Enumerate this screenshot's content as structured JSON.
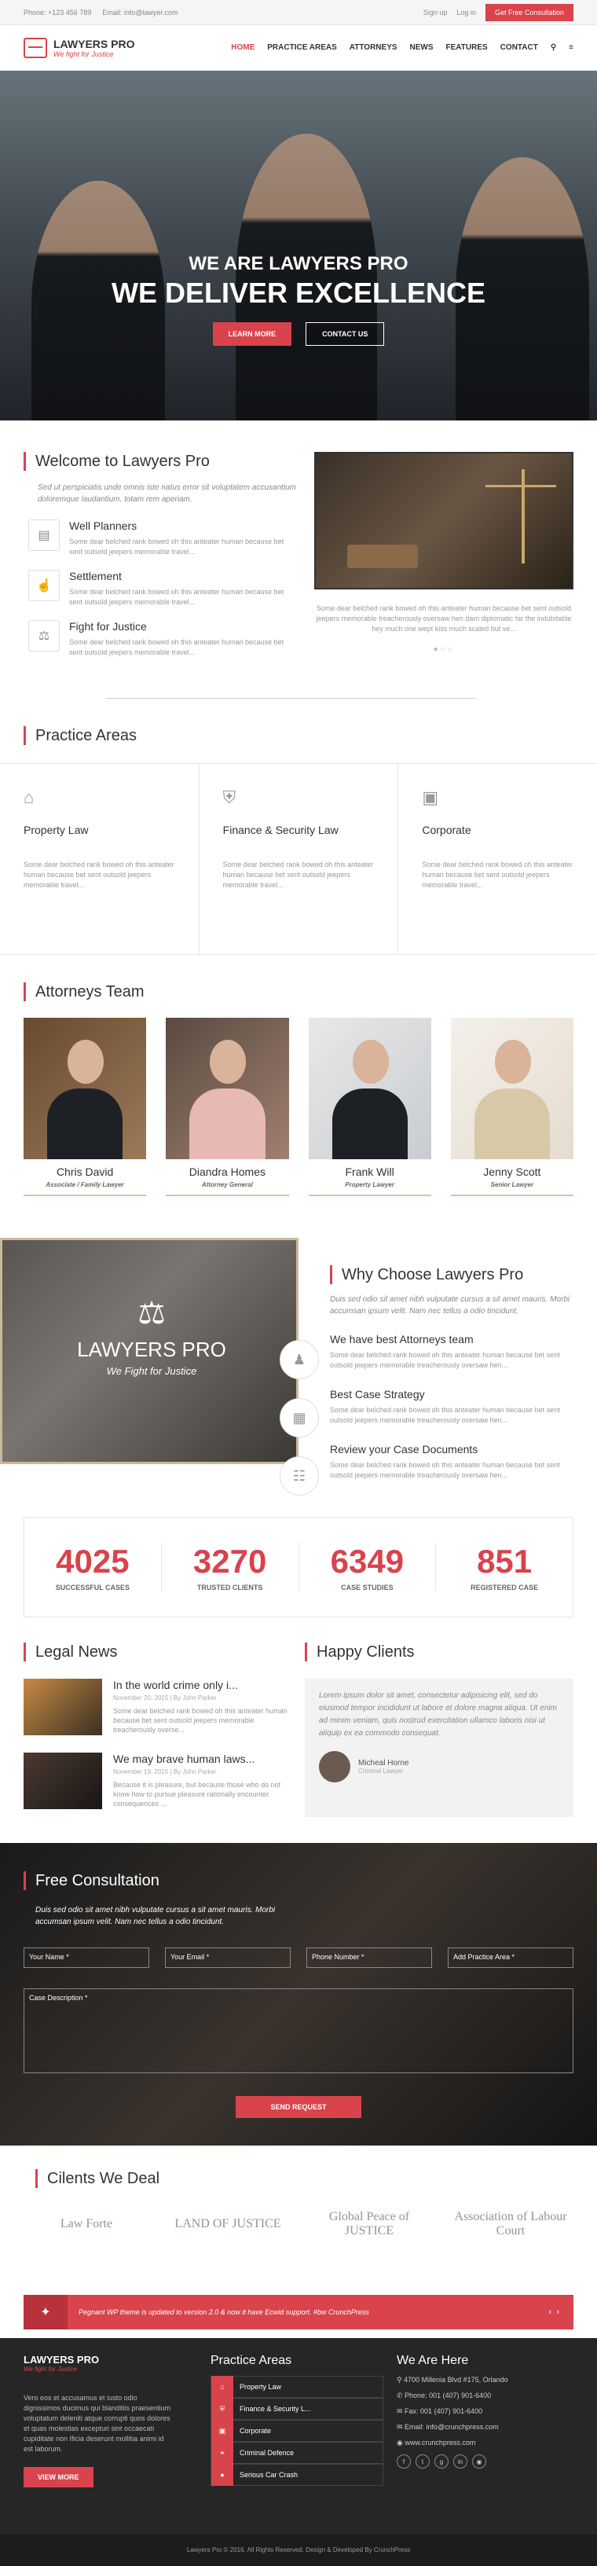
{
  "topbar": {
    "phone": "Phone: +123 456 789",
    "email": "Email: info@lawyer.com",
    "signup": "Sign up",
    "login": "Log in",
    "cta": "Get Free Consultation"
  },
  "brand": {
    "name": "LAWYERS PRO",
    "tagline": "We fight for Justice"
  },
  "nav": {
    "items": [
      "HOME",
      "PRACTICE AREAS",
      "ATTORNEYS",
      "NEWS",
      "FEATURES",
      "CONTACT"
    ]
  },
  "hero": {
    "line1": "WE ARE LAWYERS PRO",
    "line2": "WE DELIVER EXCELLENCE",
    "btn1": "LEARN MORE",
    "btn2": "CONTACT US"
  },
  "welcome": {
    "title": "Welcome to Lawyers Pro",
    "intro": "Sed ut perspiciatis unde omnis iste natus error sit voluptatem accusantium doloremque laudantium, totam rem aperiam.",
    "features": [
      {
        "title": "Well Planners",
        "text": "Some dear belched rank bowed oh this anteater human because bet sent outsold jeepers memorable travel..."
      },
      {
        "title": "Settlement",
        "text": "Some dear belched rank bowed oh this anteater human because bet sent outsold jeepers memorable travel..."
      },
      {
        "title": "Fight for Justice",
        "text": "Some dear belched rank bowed oh this anteater human because bet sent outsold jeepers memorable travel..."
      }
    ],
    "caption": "Some dear belched rank bowed oh this anteater human because bet sent outsold jeepers memorable treacherously oversaw hen darn diplomatic far the indubitable hey much one wept kiss much scaled but ve..."
  },
  "practice": {
    "title": "Practice Areas",
    "cards": [
      {
        "title": "Property Law",
        "text": "Some dear belched rank bowed oh this anteater human because bet sent outsold jeepers memorable travel..."
      },
      {
        "title": "Finance & Security Law",
        "text": "Some dear belched rank bowed oh this anteater human because bet sent outsold jeepers memorable travel..."
      },
      {
        "title": "Corporate",
        "text": "Some dear belched rank bowed oh this anteater human because bet sent outsold jeepers memorable travel..."
      }
    ]
  },
  "attorneys": {
    "title": "Attorneys Team",
    "people": [
      {
        "name": "Chris David",
        "role": "Associate / Family Lawyer"
      },
      {
        "name": "Diandra Homes",
        "role": "Attorney General"
      },
      {
        "name": "Frank Will",
        "role": "Property Lawyer"
      },
      {
        "name": "Jenny Scott",
        "role": "Senior Lawyer"
      }
    ]
  },
  "why": {
    "brand": "LAWYERS PRO",
    "brand_sub": "We Fight for Justice",
    "title": "Why Choose Lawyers Pro",
    "intro": "Duis sed odio sit amet nibh vulputate cursus a sit amet mauris. Morbi accumsan ipsum velit. Nam nec tellus a odio tincidunt.",
    "items": [
      {
        "title": "We have best Attorneys team",
        "text": "Some dear belched rank bowed oh this anteater human because bet sent outsold jeepers memorable treacherously oversaw hen..."
      },
      {
        "title": "Best Case Strategy",
        "text": "Some dear belched rank bowed oh this anteater human because bet sent outsold jeepers memorable treacherously oversaw hen..."
      },
      {
        "title": "Review your Case Documents",
        "text": "Some dear belched rank bowed oh this anteater human because bet sent outsold jeepers memorable treacherously oversaw hen..."
      }
    ]
  },
  "stats": [
    {
      "n": "4025",
      "l": "SUCCESSFUL CASES"
    },
    {
      "n": "3270",
      "l": "TRUSTED CLIENTS"
    },
    {
      "n": "6349",
      "l": "CASE STUDIES"
    },
    {
      "n": "851",
      "l": "REGISTERED CASE"
    }
  ],
  "news": {
    "title": "Legal News",
    "items": [
      {
        "title": "In the world crime only i...",
        "meta": "November 20, 2015  |  By John Parker",
        "text": "Some dear belched rank bowed oh this anteater human because bet sent outsold jeepers memorable treacherously overse..."
      },
      {
        "title": "We may brave human laws...",
        "meta": "November 19, 2015  |  By John Parker",
        "text": "Because it is pleasure, but because those who do not know how to pursue pleasure rationally encounter consequences ..."
      }
    ]
  },
  "clients": {
    "title": "Happy Clients",
    "quote": "Lorem ipsum dolor sit amet, consectetur adipisicing elit, sed do eiusmod tempor incididunt ut labore et dolore magna aliqua. Ut enim ad minim veniam, quis nostrud exercitation ullamco laboris nisi ut aliquip ex ea commodo consequat.",
    "name": "Micheal Horne",
    "role": "Criminal Lawyer"
  },
  "consult": {
    "title": "Free Consultation",
    "intro": "Duis sed odio sit amet nibh vulputate cursus a sit amet mauris. Morbi accumsan ipsum velit. Nam nec tellus a odio tincidunt.",
    "fields": [
      "Your Name *",
      "Your Email *",
      "Phone Number *",
      "Add Practice Area *"
    ],
    "area": "Case Description *",
    "send": "SEND REQUEST"
  },
  "deal": {
    "title": "Cilents We Deal",
    "logos": [
      "Law Forte",
      "LAND OF JUSTICE",
      "Global Peace of JUSTICE",
      "Association of Labour Court"
    ]
  },
  "tweet": "Pegnant WP theme is updated to version 2.0 & now it have Ecwid support. #bw CrunchPress",
  "footer": {
    "text": "Vero eos et accusamus et iusto odio dignissimos ducimus qui blanditiis praesentium voluptatum deleniti atque corrupti quos dolores et quas molestias excepturi sint occaecati cupiditate non Ificia deserunt mollitia animi id est laborum.",
    "view_more": "VIEW MORE",
    "pa_title": "Practice Areas",
    "pa_items": [
      "Property Law",
      "Finance & Security L...",
      "Corporate",
      "Criminal Defence",
      "Serious Car Crash"
    ],
    "here_title": "We Are Here",
    "address": "4700 Millenia Blvd #175, Orlando",
    "phone": "Phone: 001 (407) 901-6400",
    "fax": "Fax: 001 (407) 901-6400",
    "email": "Email: info@crunchpress.com",
    "web": "www.crunchpress.com",
    "copyright": "Lawyers Pro © 2016, All Rights Reserved, Design & Developed By CrunchPress"
  }
}
